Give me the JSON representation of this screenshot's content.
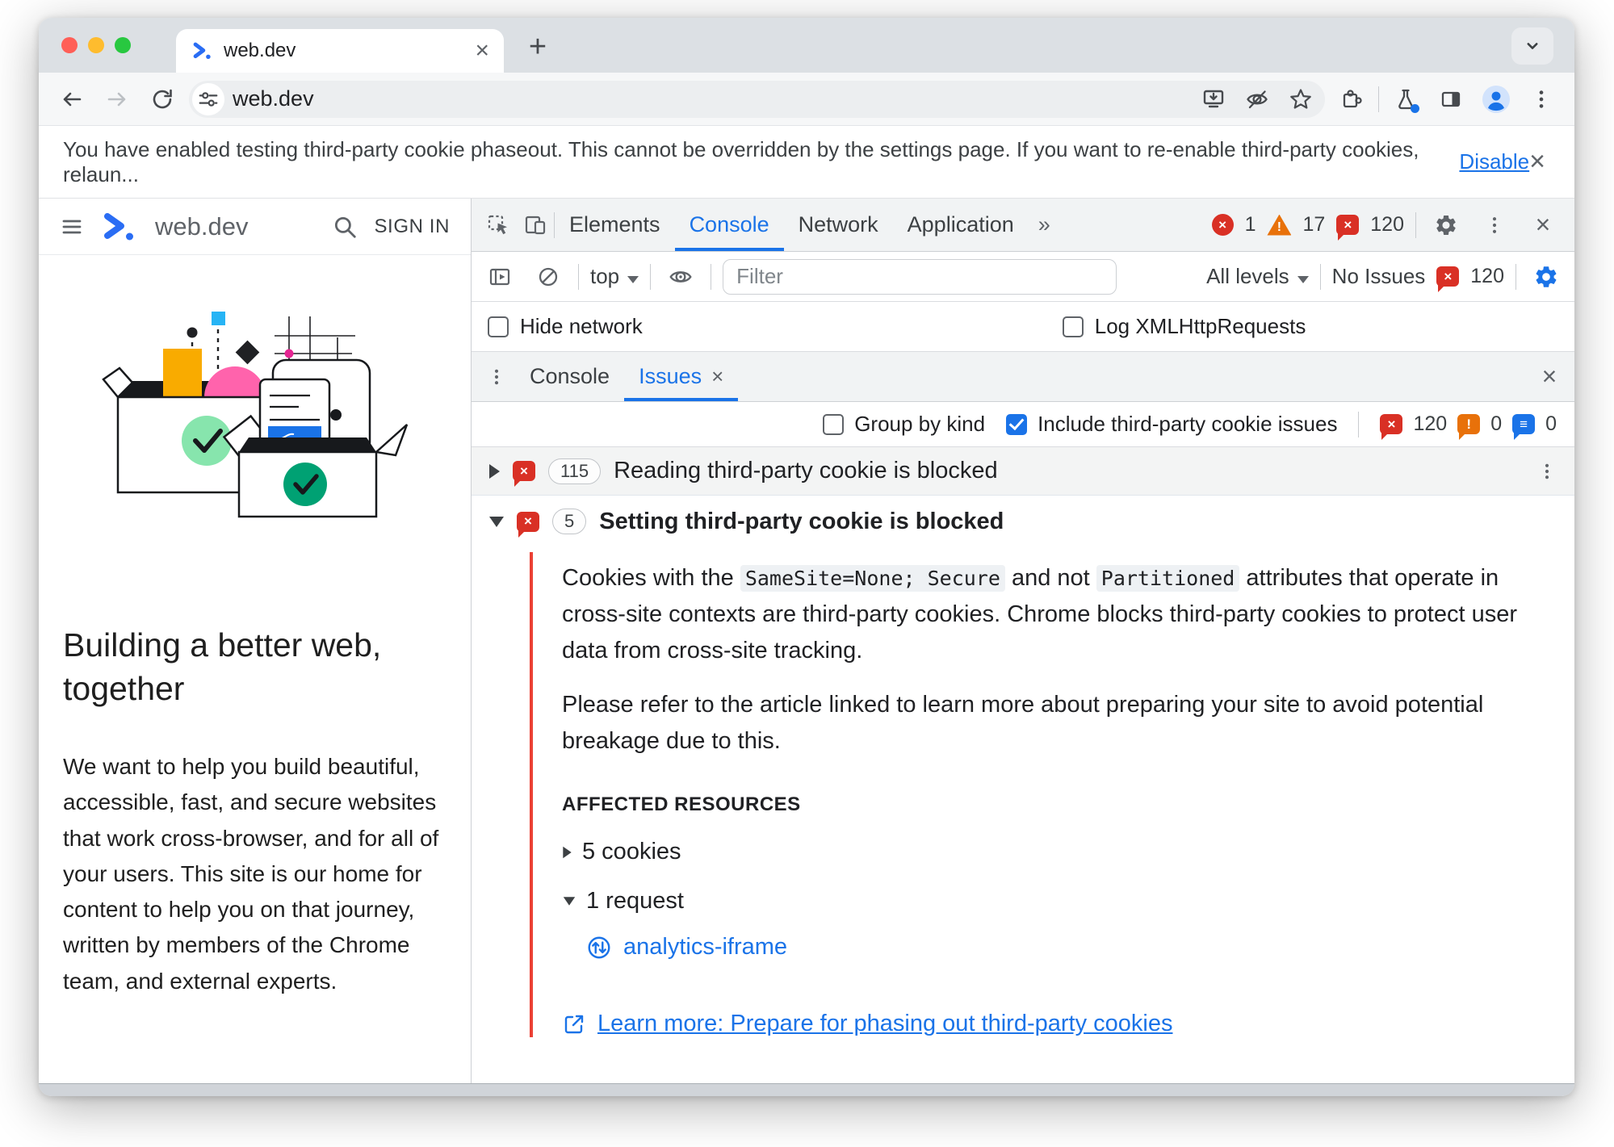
{
  "browser": {
    "tab_title": "web.dev",
    "url": "web.dev",
    "new_tab_label": "+",
    "notification": {
      "text": "You have enabled testing third-party cookie phaseout. This cannot be overridden by the settings page. If you want to re-enable third-party cookies, relaun...",
      "action": "Disable"
    }
  },
  "site": {
    "brand": "web.dev",
    "sign_in": "SIGN IN",
    "heading": "Building a better web, together",
    "paragraph": "We want to help you build beautiful, accessible, fast, and secure websites that work cross-browser, and for all of your users. This site is our home for content to help you on that journey, written by members of the Chrome team, and external experts."
  },
  "devtools": {
    "tabs": {
      "elements": "Elements",
      "console": "Console",
      "network": "Network",
      "application": "Application"
    },
    "counts": {
      "errors": "1",
      "warnings": "17",
      "issues": "120"
    },
    "toolbar": {
      "context": "top",
      "filter_placeholder": "Filter",
      "levels": "All levels",
      "no_issues": "No Issues",
      "issues_count": "120"
    },
    "checkboxes": {
      "hide_network": "Hide network",
      "log_xhr": "Log XMLHttpRequests"
    },
    "drawer": {
      "console_tab": "Console",
      "issues_tab": "Issues"
    },
    "issues_toolbar": {
      "group_by_kind": "Group by kind",
      "include_third_party": "Include third-party cookie issues",
      "badge_error": "120",
      "badge_warning": "0",
      "badge_info": "0"
    },
    "issues": {
      "reading": {
        "count": "115",
        "title": "Reading third-party cookie is blocked"
      },
      "setting": {
        "count": "5",
        "title": "Setting third-party cookie is blocked"
      }
    },
    "detail": {
      "p1_a": "Cookies with the ",
      "p1_code1": "SameSite=None; Secure",
      "p1_b": " and not ",
      "p1_code2": "Partitioned",
      "p1_c": " attributes that operate in cross-site contexts are third-party cookies. Chrome blocks third-party cookies to protect user data from cross-site tracking.",
      "p2": "Please refer to the article linked to learn more about preparing your site to avoid potential breakage due to this.",
      "affected_header": "AFFECTED RESOURCES",
      "cookies_toggle": "5 cookies",
      "requests_toggle": "1 request",
      "request_link": "analytics-iframe",
      "learn_more": "Learn more: Prepare for phasing out third-party cookies"
    }
  },
  "colors": {
    "accent_blue": "#1a73e8",
    "error_red": "#d93025",
    "warning_orange": "#e8710a",
    "issue_stripe_red": "#eb4034",
    "tabstrip_gray": "#dce0e4",
    "devtools_bar_gray": "#f1f3f4"
  }
}
